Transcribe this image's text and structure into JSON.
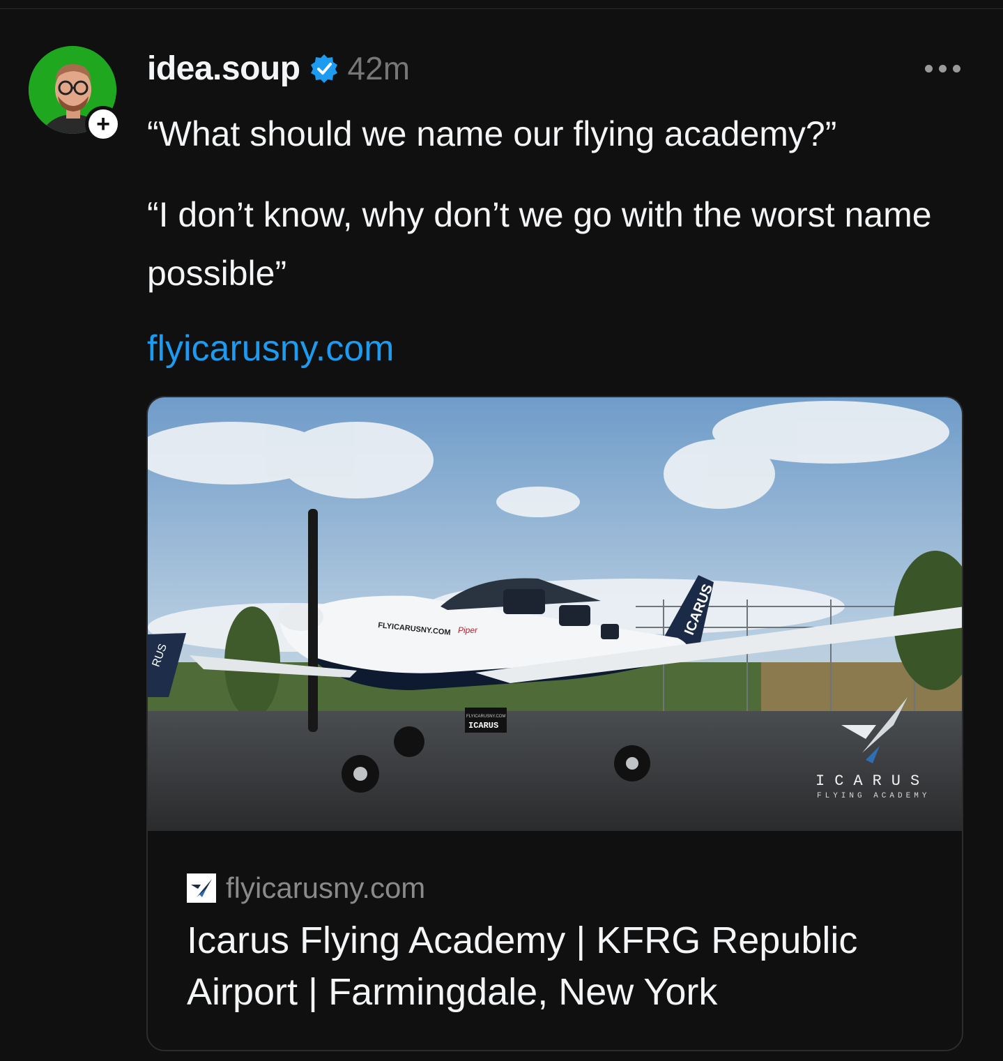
{
  "post": {
    "author": {
      "username": "idea.soup",
      "verified": true,
      "follow_label": "+"
    },
    "timestamp": "42m",
    "more_label": "More",
    "text_paragraphs": [
      "“What should we name our flying academy?”",
      "“I don’t know, why don’t we go with the worst name possible”"
    ],
    "link": "flyicarusny.com"
  },
  "link_card": {
    "domain": "flyicarusny.com",
    "title": "Icarus Flying Academy | KFRG Republic Airport | Farmingdale, New York",
    "image": {
      "plane_text": "FLYICARUSNY.COM",
      "plane_brand": "Piper",
      "tail_text": "ICARUS",
      "left_tail_text": "RUS",
      "sign_small": "FLYICARUSNY.COM",
      "sign_text": "ICARUS",
      "logo_name": "ICARUS",
      "logo_subtitle": "FLYING ACADEMY"
    }
  },
  "colors": {
    "background": "#101010",
    "text": "#f3f5f7",
    "muted": "#777777",
    "link": "#1d9bf0",
    "verified": "#1d9bf0",
    "avatar_bg": "#1fa81f"
  }
}
